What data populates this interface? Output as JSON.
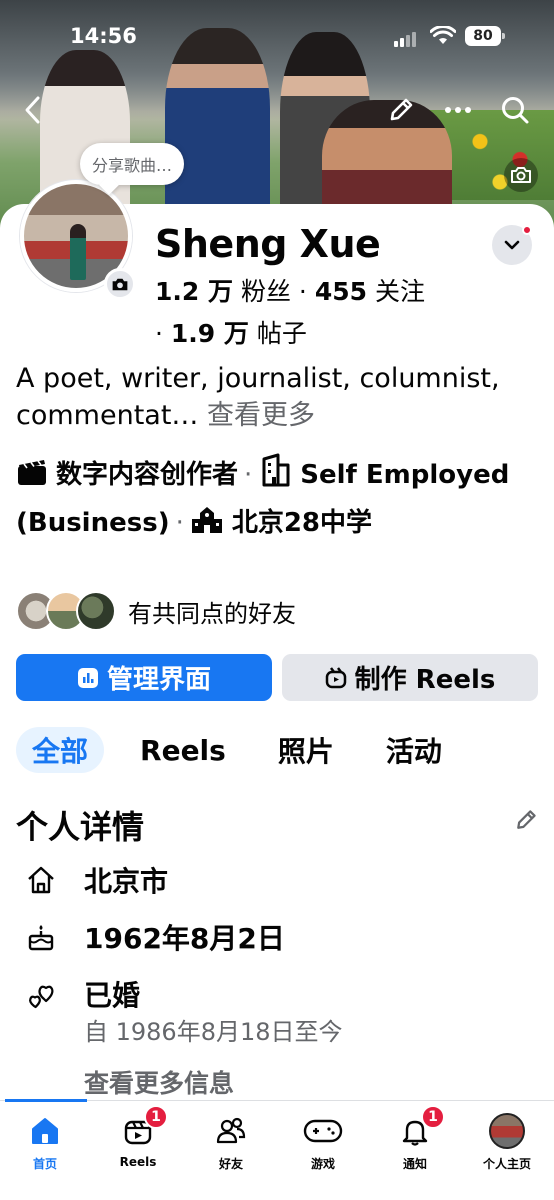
{
  "status_bar": {
    "time": "14:56",
    "battery": "80"
  },
  "cover": {
    "back_icon": "chevron-left-icon",
    "edit_icon": "pencil-icon",
    "more_icon": "more-horizontal-icon",
    "search_icon": "search-icon",
    "camera_icon": "camera-icon"
  },
  "profile": {
    "song_bubble": "分享歌曲…",
    "name": "Sheng Xue",
    "stats": {
      "followers_count": "1.2 万",
      "followers_label": "粉丝",
      "dot1": "·",
      "following_count": "455",
      "following_label": "关注",
      "dot2": "·",
      "posts_count": "1.9 万",
      "posts_label": "帖子"
    },
    "bio": "A poet, writer, journalist, columnist, commentat…",
    "bio_more": "查看更多",
    "info": {
      "category": "数字内容创作者",
      "work": "Self Employed (Business)",
      "education": "北京28中学",
      "sep": "·"
    },
    "mutual_friends": "有共同点的好友"
  },
  "actions": {
    "manage": "管理界面",
    "reels": "制作 Reels"
  },
  "tabs": [
    {
      "label": "全部",
      "active": true
    },
    {
      "label": "Reels",
      "active": false
    },
    {
      "label": "照片",
      "active": false
    },
    {
      "label": "活动",
      "active": false
    }
  ],
  "details": {
    "title": "个人详情",
    "city": "北京市",
    "birthday": "1962年8月2日",
    "relationship": "已婚",
    "relationship_since": "自 1986年8月18日至今",
    "see_more": "查看更多信息"
  },
  "bottom_nav": [
    {
      "label": "首页",
      "icon": "home-icon",
      "active": true,
      "badge": ""
    },
    {
      "label": "Reels",
      "icon": "reels-icon",
      "active": false,
      "badge": "1"
    },
    {
      "label": "好友",
      "icon": "friends-icon",
      "active": false,
      "badge": ""
    },
    {
      "label": "游戏",
      "icon": "gaming-icon",
      "active": false,
      "badge": ""
    },
    {
      "label": "通知",
      "icon": "bell-icon",
      "active": false,
      "badge": "1"
    },
    {
      "label": "个人主页",
      "icon": "profile-avatar",
      "active": false,
      "badge": ""
    }
  ],
  "colors": {
    "accent": "#1877f2",
    "badge": "#e41e3f",
    "secondary_text": "#65676b"
  }
}
